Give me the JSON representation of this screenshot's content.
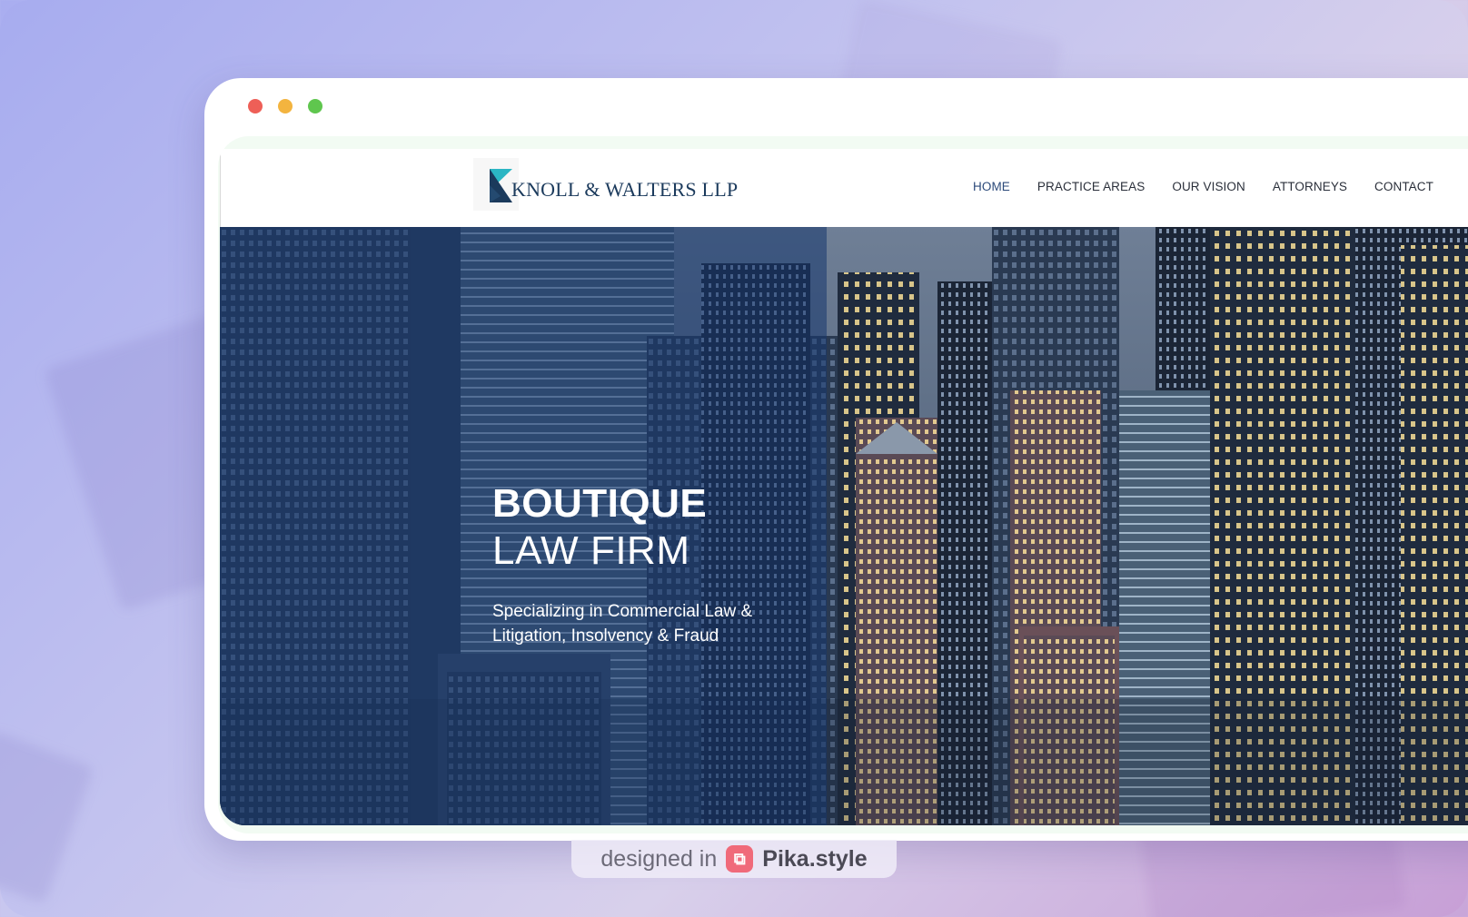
{
  "browser": {
    "traffic_lights": [
      {
        "name": "close",
        "color": "#ee5f57"
      },
      {
        "name": "minimize",
        "color": "#f3b43f"
      },
      {
        "name": "maximize",
        "color": "#5fc64e"
      }
    ]
  },
  "site": {
    "logo_text": "KNOLL & WALTERS LLP",
    "nav": [
      {
        "label": "HOME",
        "active": true
      },
      {
        "label": "PRACTICE AREAS",
        "active": false
      },
      {
        "label": "OUR VISION",
        "active": false
      },
      {
        "label": "ATTORNEYS",
        "active": false
      },
      {
        "label": "CONTACT",
        "active": false
      }
    ],
    "hero": {
      "title_line1": "BOUTIQUE",
      "title_line2": "LAW FIRM",
      "subtitle": "Specializing in Commercial Law & Litigation, Insolvency & Fraud"
    },
    "colors": {
      "brand_navy": "#1b3a5c",
      "brand_teal": "#2bb6c4",
      "hero_overlay": "#16376e"
    }
  },
  "watermark": {
    "prefix": "designed in",
    "brand": "Pika.style"
  }
}
